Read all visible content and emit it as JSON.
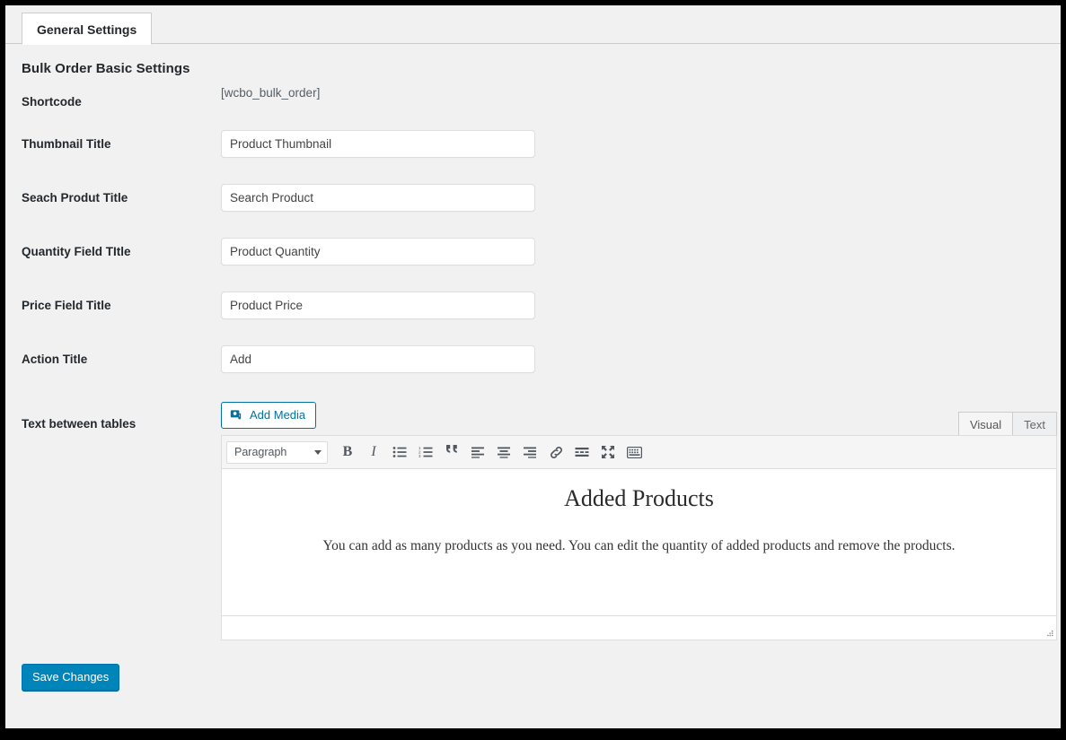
{
  "tabs": [
    {
      "label": "General Settings",
      "active": true
    }
  ],
  "page_title": "Bulk Order Basic Settings",
  "form": {
    "shortcode": {
      "label": "Shortcode",
      "value": "[wcbo_bulk_order]"
    },
    "fields": [
      {
        "label": "Thumbnail Title",
        "value": "Product Thumbnail",
        "name": "thumbnail-title"
      },
      {
        "label": "Seach Produt Title",
        "value": "Search Product",
        "name": "search-product-title"
      },
      {
        "label": "Quantity Field TItle",
        "value": "Product Quantity",
        "name": "quantity-field-title"
      },
      {
        "label": "Price Field Title",
        "value": "Product Price",
        "name": "price-field-title"
      },
      {
        "label": "Action Title",
        "value": "Add",
        "name": "action-title"
      }
    ],
    "editor": {
      "label": "Text between tables",
      "add_media_label": "Add Media",
      "add_media_icon": "media-icon",
      "view_tabs": [
        {
          "label": "Visual",
          "active": true
        },
        {
          "label": "Text",
          "active": false
        }
      ],
      "toolbar": {
        "format_select": "Paragraph",
        "buttons": [
          {
            "icon": "bold-icon",
            "glyph": "B"
          },
          {
            "icon": "italic-icon",
            "glyph": "I"
          },
          {
            "icon": "bullet-list-icon",
            "glyph": ""
          },
          {
            "icon": "numbered-list-icon",
            "glyph": ""
          },
          {
            "icon": "blockquote-icon",
            "glyph": "“"
          },
          {
            "icon": "align-left-icon",
            "glyph": ""
          },
          {
            "icon": "align-center-icon",
            "glyph": ""
          },
          {
            "icon": "align-right-icon",
            "glyph": ""
          },
          {
            "icon": "link-icon",
            "glyph": ""
          },
          {
            "icon": "read-more-icon",
            "glyph": ""
          },
          {
            "icon": "fullscreen-icon",
            "glyph": ""
          },
          {
            "icon": "toolbar-toggle-icon",
            "glyph": ""
          }
        ]
      },
      "content": {
        "heading": "Added Products",
        "paragraph": "You can add as many products as you need. You can edit the quantity of added products and remove the products."
      },
      "resize_handle_icon": "resize-handle-icon"
    }
  },
  "save_button": "Save Changes",
  "colors": {
    "accent": "#0085ba",
    "accent_border": "#0073aa",
    "page_background": "#f1f1f1",
    "border": "#dddddd",
    "text": "#23282d",
    "muted_text": "#555d66"
  }
}
